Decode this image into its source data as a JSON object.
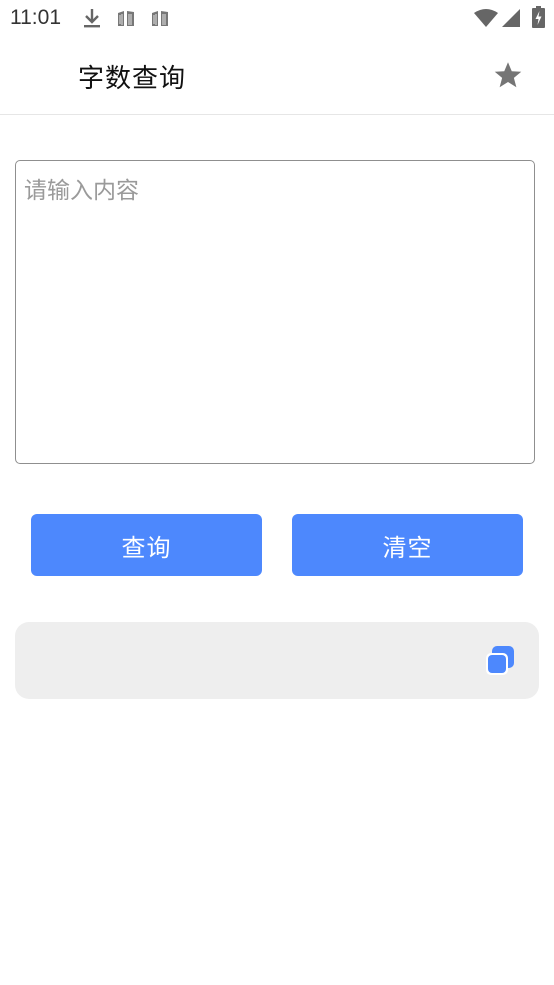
{
  "status_bar": {
    "time": "11:01",
    "icons": [
      "download-icon",
      "sim-card-icon",
      "sim-card-icon",
      "wifi-icon",
      "cellular-signal-icon",
      "battery-charging-icon"
    ]
  },
  "app_bar": {
    "title": "字数查询",
    "favorite_icon": "star-icon"
  },
  "input": {
    "value": "",
    "placeholder": "请输入内容"
  },
  "actions": {
    "query_label": "查询",
    "clear_label": "清空"
  },
  "result": {
    "text": "",
    "copy_icon": "copy-icon"
  },
  "colors": {
    "accent": "#4d88fd",
    "result_background": "#eeeeee",
    "icon_gray": "#757575"
  }
}
